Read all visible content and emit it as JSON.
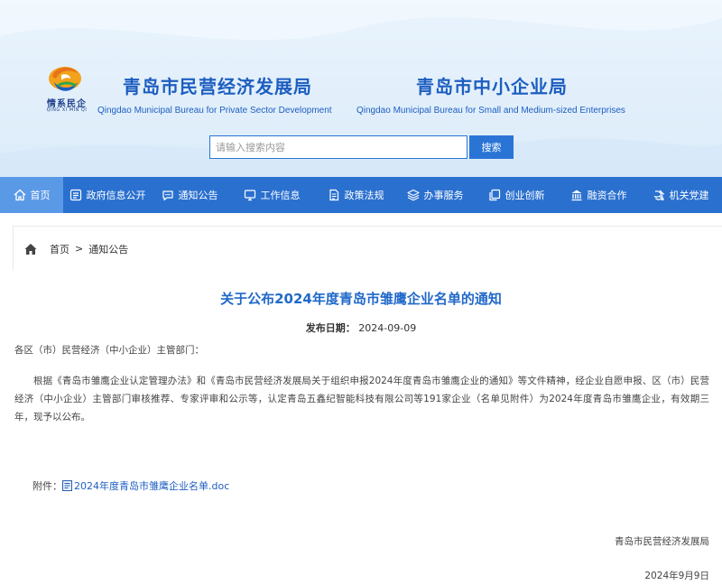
{
  "header": {
    "logo_text": "情系民企",
    "logo_sub": "QING XI MIN QI",
    "org1": {
      "cn": "青岛市民营经济发展局",
      "en": "Qingdao Municipal Bureau for Private Sector Development"
    },
    "org2": {
      "cn": "青岛市中小企业局",
      "en": "Qingdao Municipal Bureau for Small and Medium-sized Enterprises"
    },
    "search": {
      "placeholder": "请输入搜索内容",
      "button": "搜索"
    }
  },
  "nav": [
    {
      "label": "首页",
      "icon": "home-icon"
    },
    {
      "label": "政府信息公开",
      "icon": "list-icon"
    },
    {
      "label": "通知公告",
      "icon": "chat-icon"
    },
    {
      "label": "工作信息",
      "icon": "monitor-icon"
    },
    {
      "label": "政策法规",
      "icon": "document-icon"
    },
    {
      "label": "办事服务",
      "icon": "layers-icon"
    },
    {
      "label": "创业创新",
      "icon": "copy-icon"
    },
    {
      "label": "融资合作",
      "icon": "bank-icon"
    },
    {
      "label": "机关党建",
      "icon": "party-emblem-icon"
    }
  ],
  "breadcrumb": {
    "home": "首页",
    "separator": ">",
    "current": "通知公告"
  },
  "article": {
    "title": "关于公布2024年度青岛市雏鹰企业名单的通知",
    "date_label": "发布日期：",
    "date": "2024-09-09",
    "salutation": "各区（市）民营经济（中小企业）主管部门：",
    "body": "根据《青岛市雏鹰企业认定管理办法》和《青岛市民营经济发展局关于组织申报2024年度青岛市雏鹰企业的通知》等文件精神，经企业自愿申报、区（市）民营经济（中小企业）主管部门审核推荐、专家评审和公示等，认定青岛五鑫纪智能科技有限公司等191家企业（名单见附件）为2024年度青岛市雏鹰企业，有效期三年，现予以公布。",
    "attachment_label": "附件：",
    "attachment_name": "2024年度青岛市雏鹰企业名单.doc",
    "sign_org": "青岛市民营经济发展局",
    "sign_date": "2024年9月9日"
  },
  "colors": {
    "primary": "#2a70cf",
    "nav_active": "#5a99e6",
    "title": "#2169c9"
  }
}
